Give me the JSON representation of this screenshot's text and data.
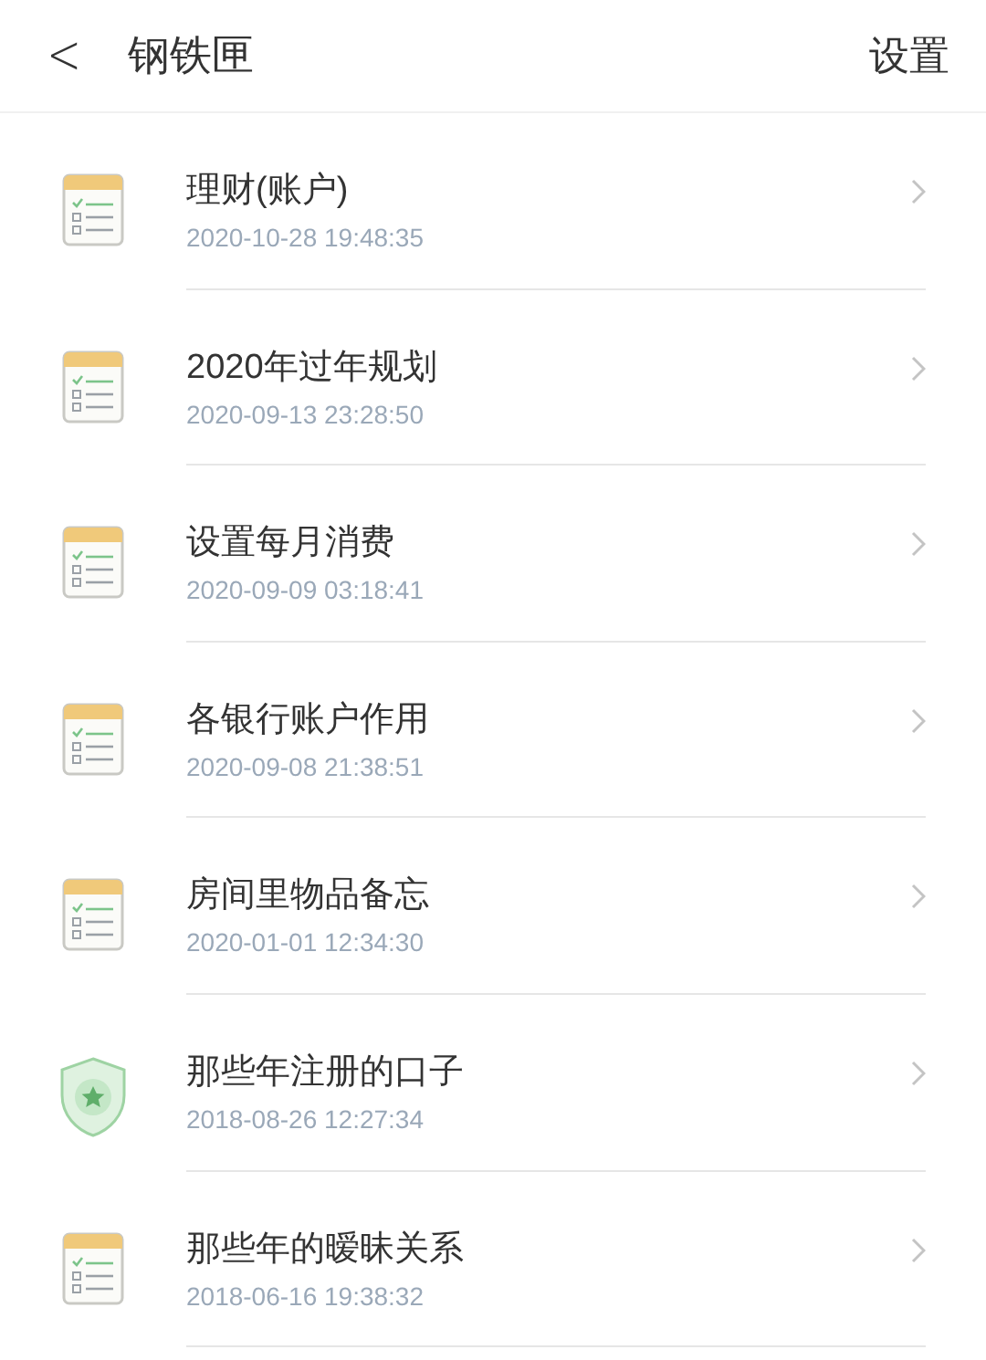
{
  "header": {
    "back": "<",
    "title": "钢铁匣",
    "action": "设置"
  },
  "items": [
    {
      "kind": "note",
      "title": "理财(账户)",
      "time": "2020-10-28 19:48:35"
    },
    {
      "kind": "note",
      "title": "2020年过年规划",
      "time": "2020-09-13 23:28:50"
    },
    {
      "kind": "note",
      "title": "设置每月消费",
      "time": "2020-09-09 03:18:41"
    },
    {
      "kind": "note",
      "title": "各银行账户作用",
      "time": "2020-09-08 21:38:51"
    },
    {
      "kind": "note",
      "title": "房间里物品备忘",
      "time": "2020-01-01 12:34:30"
    },
    {
      "kind": "vault",
      "title": "那些年注册的口子",
      "time": "2018-08-26 12:27:34"
    },
    {
      "kind": "note",
      "title": "那些年的暧昧关系",
      "time": "2018-06-16 19:38:32"
    }
  ]
}
